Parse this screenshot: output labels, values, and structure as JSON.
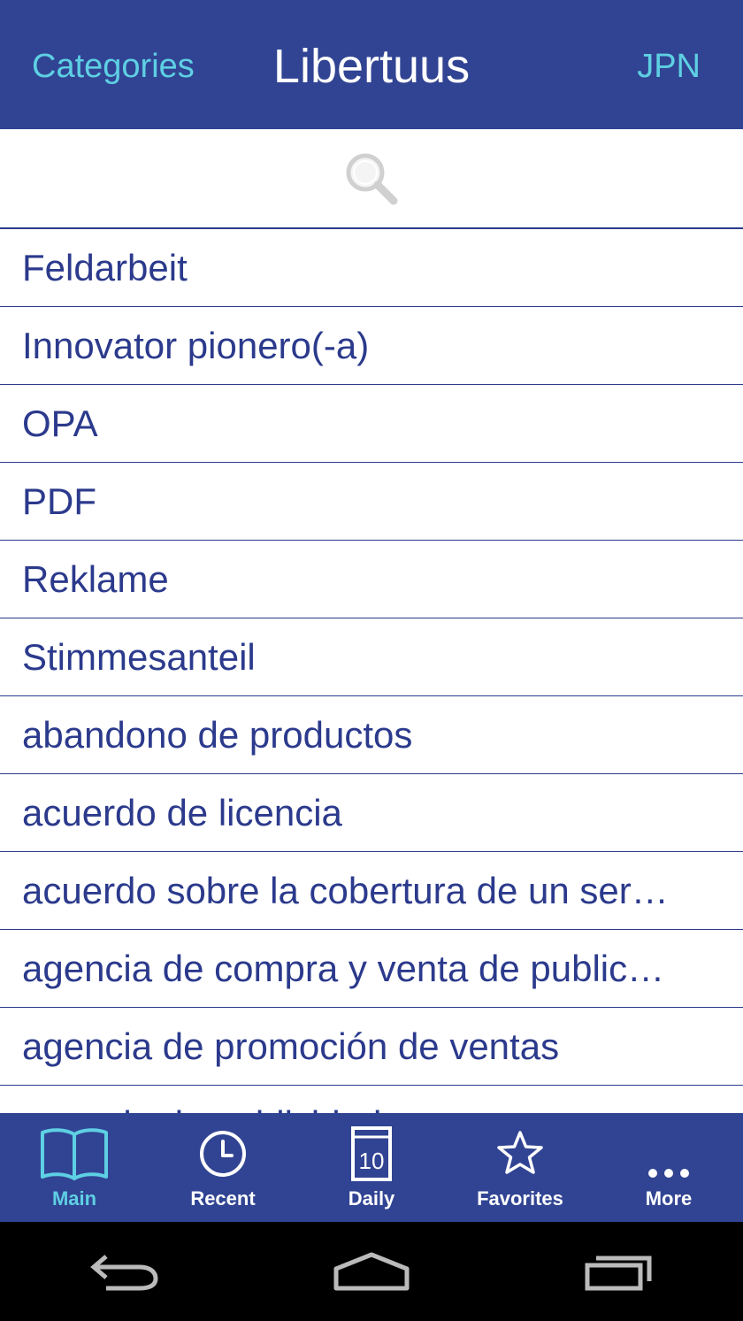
{
  "header": {
    "left_label": "Categories",
    "title": "Libertuus",
    "right_label": "JPN"
  },
  "colors": {
    "bar": "#314493",
    "accent": "#5ed0e3",
    "text": "#2b3a8c"
  },
  "list": {
    "items": [
      "Feldarbeit",
      "Innovator pionero(-a)",
      "OPA",
      "PDF",
      "Reklame",
      "Stimmesanteil",
      "abandono de productos",
      "acuerdo de licencia",
      "acuerdo sobre la cobertura de un ser…",
      "agencia de compra y venta de public…",
      "agencia de promoción de ventas",
      "agencia de publicidad"
    ]
  },
  "tabs": [
    {
      "label": "Main",
      "icon": "book-icon",
      "active": true
    },
    {
      "label": "Recent",
      "icon": "clock-icon",
      "active": false
    },
    {
      "label": "Daily",
      "icon": "calendar-icon",
      "day": "10",
      "active": false
    },
    {
      "label": "Favorites",
      "icon": "star-icon",
      "active": false
    },
    {
      "label": "More",
      "icon": "more-dots-icon",
      "active": false
    }
  ],
  "system_nav": [
    "back-icon",
    "home-icon",
    "recents-icon"
  ]
}
